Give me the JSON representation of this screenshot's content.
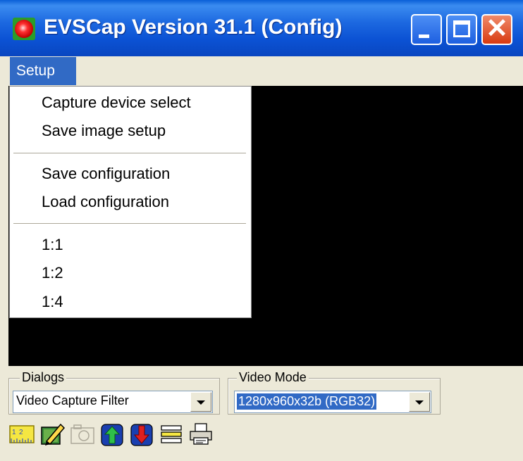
{
  "window": {
    "title": "EVSCap Version 31.1 (Config)",
    "controls": {
      "minimize": "minimize",
      "maximize": "maximize",
      "close": "close"
    }
  },
  "menubar": {
    "setup": "Setup"
  },
  "setup_menu": {
    "items": [
      "Capture device select",
      "Save image setup",
      "Save configuration",
      "Load configuration",
      "1:1",
      "1:2",
      "1:4"
    ]
  },
  "dialogs": {
    "label": "Dialogs",
    "value": "Video Capture Filter"
  },
  "video_mode": {
    "label": "Video Mode",
    "value": "1280x960x32b (RGB32)"
  },
  "toolbar": {
    "icons": [
      "ruler-icon",
      "edit-image-icon",
      "camera-icon",
      "upload-icon",
      "download-icon",
      "list-icon",
      "print-icon"
    ]
  },
  "colors": {
    "titlebar": "#0b52d4",
    "menu_highlight": "#316ac5",
    "close_button": "#d83a10",
    "window_bg": "#ece9d8",
    "video_bg": "#000000"
  }
}
